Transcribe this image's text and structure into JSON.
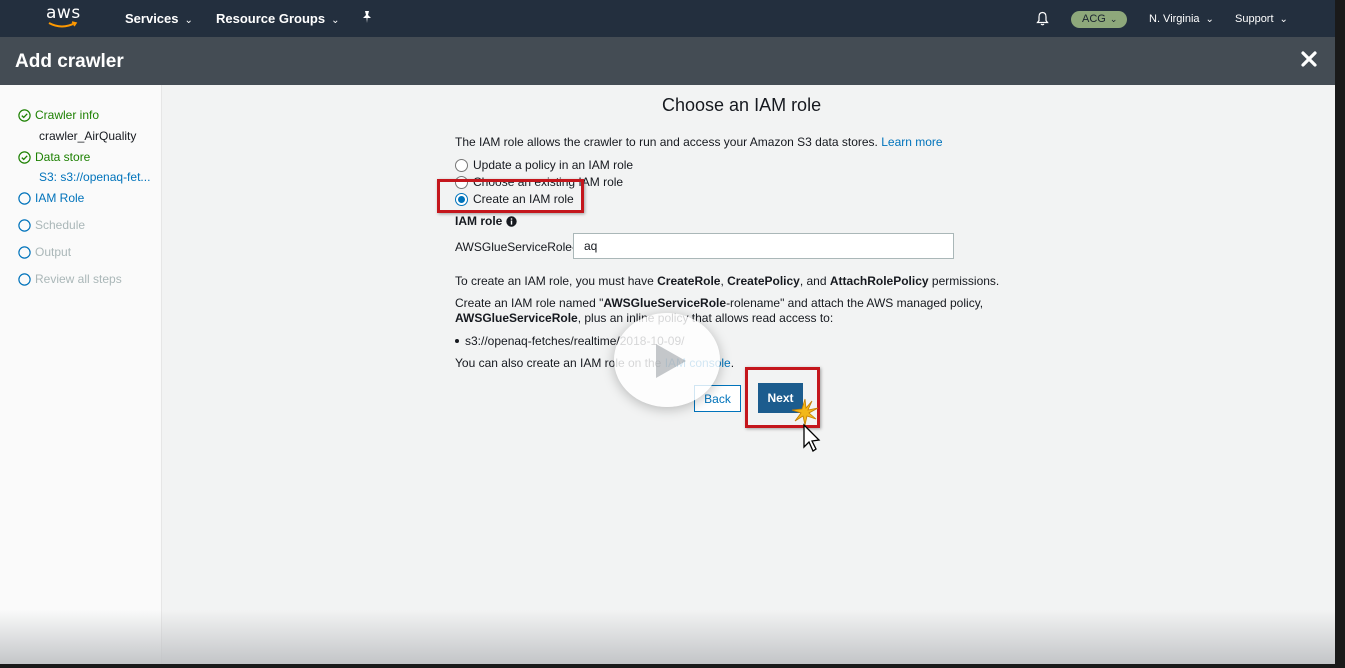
{
  "topnav": {
    "logo_text": "aws",
    "services": "Services",
    "resource_groups": "Resource Groups",
    "account_badge": "ACG",
    "region": "N. Virginia",
    "support": "Support"
  },
  "header": {
    "title": "Add crawler"
  },
  "sidebar": {
    "steps": [
      {
        "label": "Crawler info",
        "status": "done",
        "detail": "crawler_AirQuality"
      },
      {
        "label": "Data store",
        "status": "done",
        "detail": "S3: s3://openaq-fet..."
      },
      {
        "label": "IAM Role",
        "status": "active"
      },
      {
        "label": "Schedule",
        "status": "pending"
      },
      {
        "label": "Output",
        "status": "pending"
      },
      {
        "label": "Review all steps",
        "status": "pending"
      }
    ]
  },
  "main": {
    "title": "Choose an IAM role",
    "intro": "The IAM role allows the crawler to run and access your Amazon S3 data stores.",
    "learn_more": "Learn more",
    "options": [
      {
        "label": "Update a policy in an IAM role",
        "selected": false
      },
      {
        "label": "Choose an existing IAM role",
        "selected": false
      },
      {
        "label": "Create an IAM role",
        "selected": true
      }
    ],
    "iam_role_label": "IAM role",
    "role_prefix": "AWSGlueServiceRole-",
    "role_value": "aq",
    "perm_text_1": "To create an IAM role, you must have ",
    "perm_create_role": "CreateRole",
    "perm_sep_1": ", ",
    "perm_create_policy": "CreatePolicy",
    "perm_sep_2": ", and ",
    "perm_attach": "AttachRolePolicy",
    "perm_text_2": " permissions.",
    "create_text_1": "Create an IAM role named \"",
    "create_role_name": "AWSGlueServiceRole",
    "create_text_2": "-rolename\" and attach the AWS managed policy,",
    "create_policy_name": "AWSGlueServiceRole",
    "create_text_3": ", plus an inline policy that allows read access to:",
    "s3_path": "s3://openaq-fetches/realtime/2018-10-09/",
    "console_text": "You can also create an IAM role on the ",
    "console_link": "IAM console",
    "console_end": ".",
    "back": "Back",
    "next": "Next"
  },
  "colors": {
    "nav_bg": "#232f3e",
    "header_bg": "#444c54",
    "link": "#0073bb",
    "done_green": "#1d8102",
    "highlight_red": "#c4161c",
    "next_bg": "#1c5c8e"
  }
}
